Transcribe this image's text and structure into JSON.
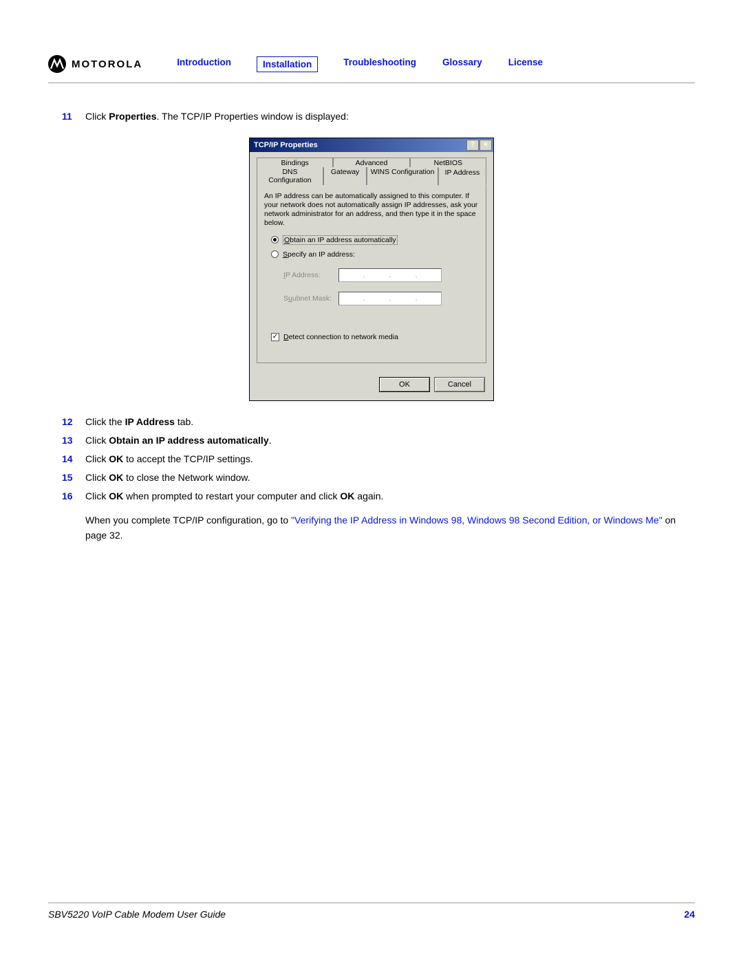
{
  "header": {
    "logo_text": "MOTOROLA",
    "nav": {
      "intro": "Introduction",
      "install": "Installation",
      "trouble": "Troubleshooting",
      "glossary": "Glossary",
      "license": "License"
    }
  },
  "step11": {
    "num": "11",
    "pre": "Click ",
    "bold": "Properties",
    "post": ". The TCP/IP Properties window is displayed:"
  },
  "dialog": {
    "title": "TCP/IP Properties",
    "help_btn": "?",
    "close_btn": "×",
    "tabs_row1": {
      "bindings": "Bindings",
      "advanced": "Advanced",
      "netbios": "NetBIOS"
    },
    "tabs_row2": {
      "dns": "DNS Configuration",
      "gateway": "Gateway",
      "wins": "WINS Configuration",
      "ip": "IP Address"
    },
    "desc": "An IP address can be automatically assigned to this computer. If your network does not automatically assign IP addresses, ask your network administrator for an address, and then type it in the space below.",
    "radio1_u": "O",
    "radio1_rest": "btain an IP address automatically",
    "radio2_u": "S",
    "radio2_rest": "pecify an IP address:",
    "ip_label_u": "I",
    "ip_label_rest": "P Address:",
    "subnet_label": "S",
    "subnet_label_rest": "ubnet Mask:",
    "detect_u": "D",
    "detect_rest": "etect connection to network media",
    "ok": "OK",
    "cancel": "Cancel",
    "checkmark": "✓"
  },
  "steps": {
    "s12": {
      "num": "12",
      "pre": "Click the ",
      "bold": "IP Address",
      "post": " tab."
    },
    "s13": {
      "num": "13",
      "pre": "Click ",
      "bold": "Obtain an IP address automatically",
      "post": "."
    },
    "s14": {
      "num": "14",
      "pre": "Click ",
      "bold": "OK",
      "post": " to accept the TCP/IP settings."
    },
    "s15": {
      "num": "15",
      "pre": "Click ",
      "bold": "OK",
      "post": " to close the Network window."
    },
    "s16": {
      "num": "16",
      "pre": "Click ",
      "bold1": "OK",
      "mid": " when prompted to restart your computer and click ",
      "bold2": "OK",
      "post": " again."
    }
  },
  "para": {
    "pre": "When you complete TCP/IP configuration, go to ",
    "link": "\"Verifying the IP Address in Windows 98, Windows 98 Second Edition, or Windows Me\"",
    "post": " on page 32."
  },
  "footer": {
    "guide": "SBV5220 VoIP Cable Modem User Guide",
    "page": "24"
  }
}
